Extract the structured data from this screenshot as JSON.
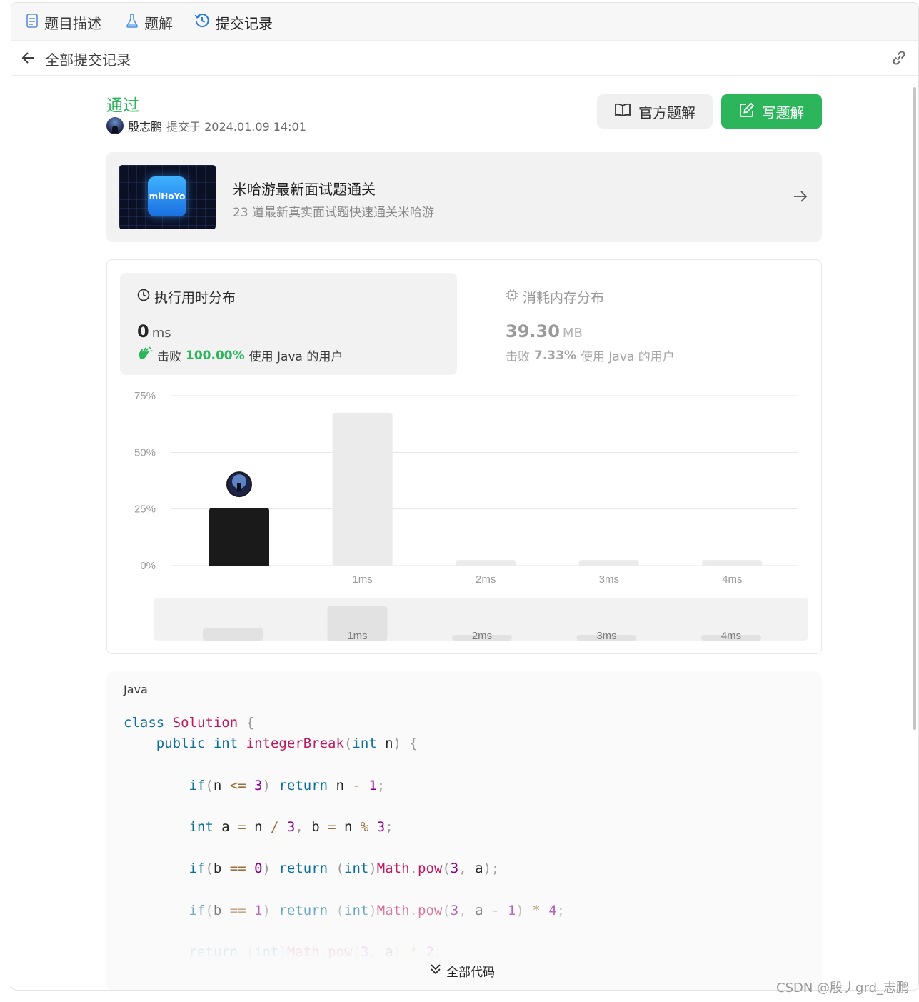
{
  "tabs": [
    {
      "label": "题目描述",
      "icon": "document-icon"
    },
    {
      "label": "题解",
      "icon": "flask-icon"
    },
    {
      "label": "提交记录",
      "icon": "history-icon",
      "active": true
    }
  ],
  "subheader": {
    "title": "全部提交记录"
  },
  "submission": {
    "status": "通过",
    "user": "殷志鹏",
    "submitted_text": "提交于 2024.01.09 14:01"
  },
  "actions": {
    "official": "官方题解",
    "write": "写题解"
  },
  "promo": {
    "logo_text": "miHoYo",
    "title": "米哈游最新面试题通关",
    "subtitle": "23 道最新真实面试题快速通关米哈游"
  },
  "runtime": {
    "title": "执行用时分布",
    "value": "0",
    "unit": "ms",
    "beat_prefix": "击败",
    "beat_pct": "100.00%",
    "beat_suffix": "使用 Java 的用户"
  },
  "memory": {
    "title": "消耗内存分布",
    "value": "39.30",
    "unit": "MB",
    "beat_prefix": "击败",
    "beat_pct": "7.33%",
    "beat_suffix": "使用 Java 的用户"
  },
  "chart_data": {
    "type": "bar",
    "categories": [
      "0ms",
      "1ms",
      "2ms",
      "3ms",
      "4ms"
    ],
    "x_tick_labels": [
      "",
      "1ms",
      "2ms",
      "3ms",
      "4ms"
    ],
    "values": [
      25.5,
      67.5,
      2.5,
      2.5,
      2.5
    ],
    "highlight_index": 0,
    "ylim": [
      0,
      75
    ],
    "yticks": [
      "0%",
      "25%",
      "50%",
      "75%"
    ],
    "ytick_values": [
      0,
      25,
      50,
      75
    ],
    "grid": true,
    "colors": {
      "highlight": "#1a1a1a",
      "bar": "#ebebeb",
      "grid": "#e6e6e6"
    }
  },
  "minimap": {
    "labels": [
      "",
      "1ms",
      "2ms",
      "3ms",
      "4ms"
    ],
    "values": [
      25.5,
      67.5,
      2.5,
      2.5,
      2.5
    ]
  },
  "code": {
    "language": "Java",
    "expand_label": "全部代码"
  },
  "watermark": "CSDN @殷丿grd_志鹏"
}
